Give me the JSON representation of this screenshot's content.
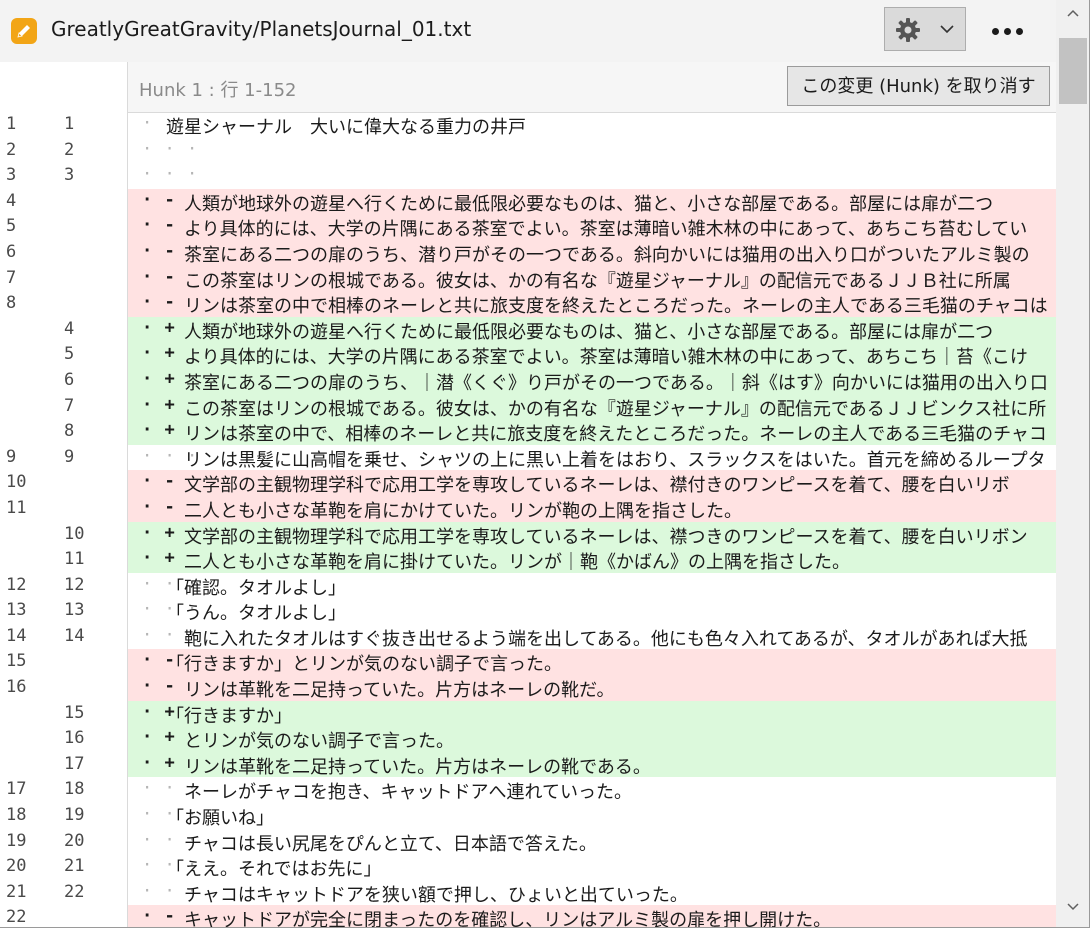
{
  "window": {
    "title": "GreatlyGreatGravity/PlanetsJournal_01.txt"
  },
  "toolbar": {
    "settings_icon": "gear-icon",
    "dropdown_icon": "chevron-down-icon",
    "more_icon": "more-horizontal-icon"
  },
  "hunk": {
    "label": "Hunk 1 : 行 1-152",
    "revert_label": "この変更 (Hunk) を取り消す"
  },
  "colors": {
    "deleted_bg": "#ffe2e2",
    "added_bg": "#dcf9dc",
    "file_icon": "#f2a516"
  },
  "lines": [
    {
      "old": "1",
      "new": "1",
      "type": "ctx",
      "mark": "· · ·",
      "text": "遊星シャーナル　大いに偉大なる重力の井戸"
    },
    {
      "old": "2",
      "new": "2",
      "type": "ctx",
      "mark": "· · ·",
      "text": ""
    },
    {
      "old": "3",
      "new": "3",
      "type": "ctx",
      "mark": "· · ·",
      "text": ""
    },
    {
      "old": "4",
      "new": "",
      "type": "del",
      "mark": "· -",
      "text": "　人類が地球外の遊星へ行くために最低限必要なものは、猫と、小さな部屋である。部屋には扉が二つ"
    },
    {
      "old": "5",
      "new": "",
      "type": "del",
      "mark": "· -",
      "text": "　より具体的には、大学の片隅にある茶室でよい。茶室は薄暗い雑木林の中にあって、あちこち苔むしてい"
    },
    {
      "old": "6",
      "new": "",
      "type": "del",
      "mark": "· -",
      "text": "　茶室にある二つの扉のうち、潜り戸がその一つである。斜向かいには猫用の出入り口がついたアルミ製の"
    },
    {
      "old": "7",
      "new": "",
      "type": "del",
      "mark": "· -",
      "text": "　この茶室はリンの根城である。彼女は、かの有名な『遊星ジャーナル』の配信元であるＪＪＢ社に所属"
    },
    {
      "old": "8",
      "new": "",
      "type": "del",
      "mark": "· -",
      "text": "　リンは茶室の中で相棒のネーレと共に旅支度を終えたところだった。ネーレの主人である三毛猫のチャコは"
    },
    {
      "old": "",
      "new": "4",
      "type": "add",
      "mark": "· +",
      "text": "　人類が地球外の遊星へ行くために最低限必要なものは、猫と、小さな部屋である。部屋には扉が二つ"
    },
    {
      "old": "",
      "new": "5",
      "type": "add",
      "mark": "· +",
      "text": "　より具体的には、大学の片隅にある茶室でよい。茶室は薄暗い雑木林の中にあって、あちこち｜苔《こけ"
    },
    {
      "old": "",
      "new": "6",
      "type": "add",
      "mark": "· +",
      "text": "　茶室にある二つの扉のうち、｜潜《くぐ》り戸がその一つである。｜斜《はす》向かいには猫用の出入り口"
    },
    {
      "old": "",
      "new": "7",
      "type": "add",
      "mark": "· +",
      "text": "　この茶室はリンの根城である。彼女は、かの有名な『遊星ジャーナル』の配信元であるＪＪビンクス社に所"
    },
    {
      "old": "",
      "new": "8",
      "type": "add",
      "mark": "· +",
      "text": "　リンは茶室の中で、相棒のネーレと共に旅支度を終えたところだった。ネーレの主人である三毛猫のチャコ"
    },
    {
      "old": "9",
      "new": "9",
      "type": "ctx",
      "mark": "· · ·",
      "text": "　リンは黒髪に山高帽を乗せ、シャツの上に黒い上着をはおり、スラックスをはいた。首元を締めるループタ"
    },
    {
      "old": "10",
      "new": "",
      "type": "del",
      "mark": "· -",
      "text": "　文学部の主観物理学科で応用工学を専攻しているネーレは、襟付きのワンピースを着て、腰を白いリボ"
    },
    {
      "old": "11",
      "new": "",
      "type": "del",
      "mark": "· -",
      "text": "　二人とも小さな革鞄を肩にかけていた。リンが鞄の上隅を指さした。"
    },
    {
      "old": "",
      "new": "10",
      "type": "add",
      "mark": "· +",
      "text": "　文学部の主観物理学科で応用工学を専攻しているネーレは、襟つきのワンピースを着て、腰を白いリボン"
    },
    {
      "old": "",
      "new": "11",
      "type": "add",
      "mark": "· +",
      "text": "　二人とも小さな革鞄を肩に掛けていた。リンが｜鞄《かばん》の上隅を指さした。"
    },
    {
      "old": "12",
      "new": "12",
      "type": "ctx",
      "mark": "· · ·",
      "text": "「確認。タオルよし」"
    },
    {
      "old": "13",
      "new": "13",
      "type": "ctx",
      "mark": "· · ·",
      "text": "「うん。タオルよし」"
    },
    {
      "old": "14",
      "new": "14",
      "type": "ctx",
      "mark": "· · ·",
      "text": "　鞄に入れたタオルはすぐ抜き出せるよう端を出してある。他にも色々入れてあるが、タオルがあれば大抵"
    },
    {
      "old": "15",
      "new": "",
      "type": "del",
      "mark": "· -",
      "text": "「行きますか」とリンが気のない調子で言った。"
    },
    {
      "old": "16",
      "new": "",
      "type": "del",
      "mark": "· -",
      "text": "　リンは革靴を二足持っていた。片方はネーレの靴だ。"
    },
    {
      "old": "",
      "new": "15",
      "type": "add",
      "mark": "· +",
      "text": "「行きますか」"
    },
    {
      "old": "",
      "new": "16",
      "type": "add",
      "mark": "· +",
      "text": "　とリンが気のない調子で言った。"
    },
    {
      "old": "",
      "new": "17",
      "type": "add",
      "mark": "· +",
      "text": "　リンは革靴を二足持っていた。片方はネーレの靴である。"
    },
    {
      "old": "17",
      "new": "18",
      "type": "ctx",
      "mark": "· · ·",
      "text": "　ネーレがチャコを抱き、キャットドアへ連れていった。"
    },
    {
      "old": "18",
      "new": "19",
      "type": "ctx",
      "mark": "· · ·",
      "text": "「お願いね」"
    },
    {
      "old": "19",
      "new": "20",
      "type": "ctx",
      "mark": "· · ·",
      "text": "　チャコは長い尻尾をぴんと立て、日本語で答えた。"
    },
    {
      "old": "20",
      "new": "21",
      "type": "ctx",
      "mark": "· · ·",
      "text": "「ええ。それではお先に」"
    },
    {
      "old": "21",
      "new": "22",
      "type": "ctx",
      "mark": "· · ·",
      "text": "　チャコはキャットドアを狭い額で押し、ひょいと出ていった。"
    },
    {
      "old": "22",
      "new": "",
      "type": "del",
      "mark": "· -",
      "text": "　キャットドアが完全に閉まったのを確認し、リンはアルミ製の扉を押し開けた。"
    }
  ]
}
